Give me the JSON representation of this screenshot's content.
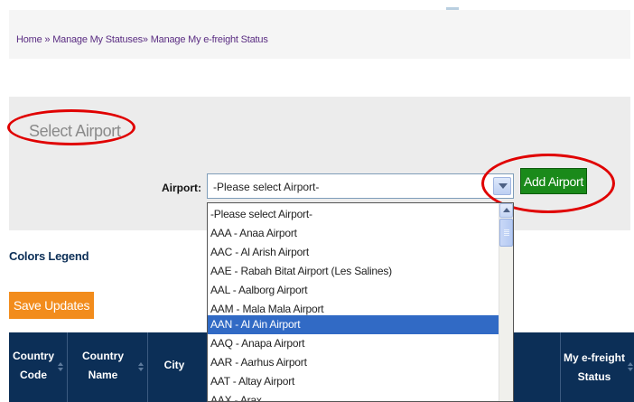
{
  "breadcrumb": {
    "home": "Home",
    "separator": "»",
    "statuses": "Manage My Statuses",
    "current": "Manage My e-freight Status"
  },
  "panel": {
    "title": "Select Airport",
    "airport_label": "Airport:",
    "selected_value": "-Please select Airport-",
    "add_button": "Add Airport"
  },
  "dropdown": {
    "options": [
      "-Please select Airport-",
      "AAA - Anaa Airport",
      "AAC - Al Arish Airport",
      "AAE - Rabah Bitat Airport (Les Salines)",
      "AAL - Aalborg Airport",
      "AAM - Mala Mala Airport",
      "AAN - Al Ain Airport",
      "AAQ - Anapa Airport",
      "AAR - Aarhus Airport",
      "AAT - Altay Airport",
      "AAX - Arax"
    ],
    "highlighted_index": 6
  },
  "legend": {
    "title": "Colors Legend"
  },
  "actions": {
    "save_updates": "Save Updates"
  },
  "table": {
    "headers": [
      {
        "line1": "Country",
        "line2": "Code"
      },
      {
        "line1": "Country",
        "line2": "Name"
      },
      {
        "line1": "City",
        "line2": ""
      },
      {
        "line1": "My e-freight",
        "line2": "Status"
      }
    ]
  },
  "colors": {
    "header_bg": "#0c2f57",
    "add_button": "#1a8a1a",
    "save_button": "#f28c1c",
    "highlight": "#316ac5",
    "annotation": "#e00000"
  },
  "icons": [
    "select-arrow-icon",
    "scroll-up-icon",
    "sort-icon"
  ]
}
